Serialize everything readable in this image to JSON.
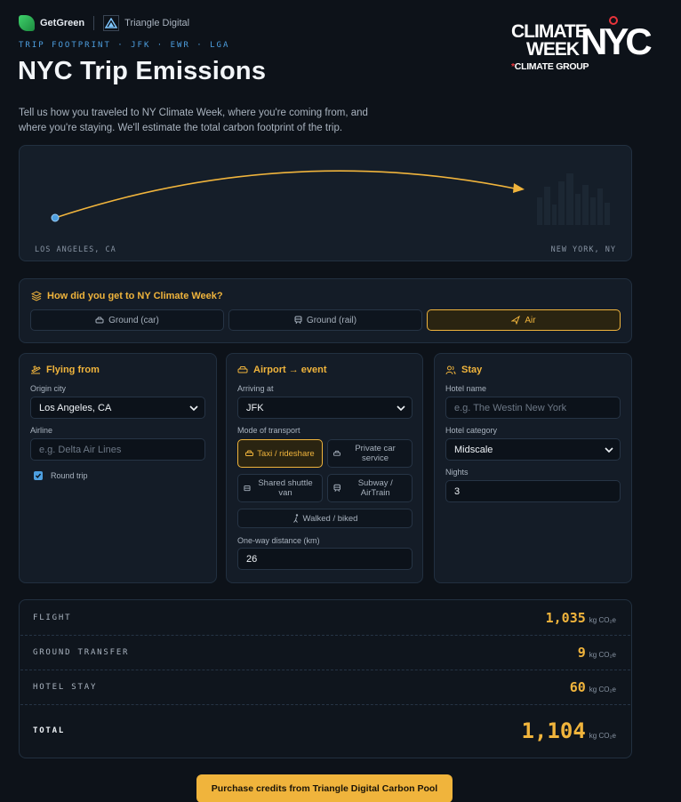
{
  "brands": {
    "getgreen": "GetGreen",
    "triangle": "Triangle Digital"
  },
  "kicker": "TRIP FOOTPRINT · JFK · EWR · LGA",
  "title": "NYC Trip Emissions",
  "intro": "Tell us how you traveled to NY Climate Week, where you're coming from, and where you're staying. We'll estimate the total carbon footprint of the trip.",
  "logo": {
    "line1": "CLIMATE",
    "line2": "WEEK",
    "nyc": "NYC",
    "group": "CLIMATE GROUP"
  },
  "map": {
    "origin_label": "LOS ANGELES, CA",
    "dest_label": "NEW YORK, NY"
  },
  "transport": {
    "question": "How did you get to NY Climate Week?",
    "options": [
      {
        "label": "Ground (car)",
        "icon": "car-icon"
      },
      {
        "label": "Ground (rail)",
        "icon": "train-icon"
      },
      {
        "label": "Air",
        "icon": "plane-icon",
        "selected": true
      }
    ]
  },
  "flying_from": {
    "heading": "Flying from",
    "origin_label": "Origin city",
    "origin_value": "Los Angeles, CA",
    "airline_label": "Airline",
    "airline_placeholder": "e.g. Delta Air Lines",
    "round_trip_label": "Round trip",
    "round_trip_checked": true
  },
  "airport": {
    "heading": "Airport → event",
    "arriving_label": "Arriving at",
    "arriving_value": "JFK",
    "mode_label": "Mode of transport",
    "modes": [
      {
        "label": "Taxi / rideshare",
        "selected": true
      },
      {
        "label": "Private car service"
      },
      {
        "label": "Shared shuttle van"
      },
      {
        "label": "Subway / AirTrain"
      },
      {
        "label": "Walked / biked"
      }
    ],
    "distance_label": "One-way distance (km)",
    "distance_value": "26"
  },
  "stay": {
    "heading": "Stay",
    "hotel_label": "Hotel name",
    "hotel_placeholder": "e.g. The Westin New York",
    "category_label": "Hotel category",
    "category_value": "Midscale",
    "nights_label": "Nights",
    "nights_value": "3"
  },
  "summary": {
    "unit": "kg CO₂e",
    "rows": [
      {
        "label": "FLIGHT",
        "value": "1,035"
      },
      {
        "label": "GROUND TRANSFER",
        "value": "9"
      },
      {
        "label": "HOTEL STAY",
        "value": "60"
      }
    ],
    "total_label": "TOTAL",
    "total_value": "1,104"
  },
  "cta": "Purchase credits from Triangle Digital Carbon Pool",
  "colors": {
    "accent": "#f0b43c",
    "link": "#4d9fe0",
    "background": "#0d1219"
  }
}
